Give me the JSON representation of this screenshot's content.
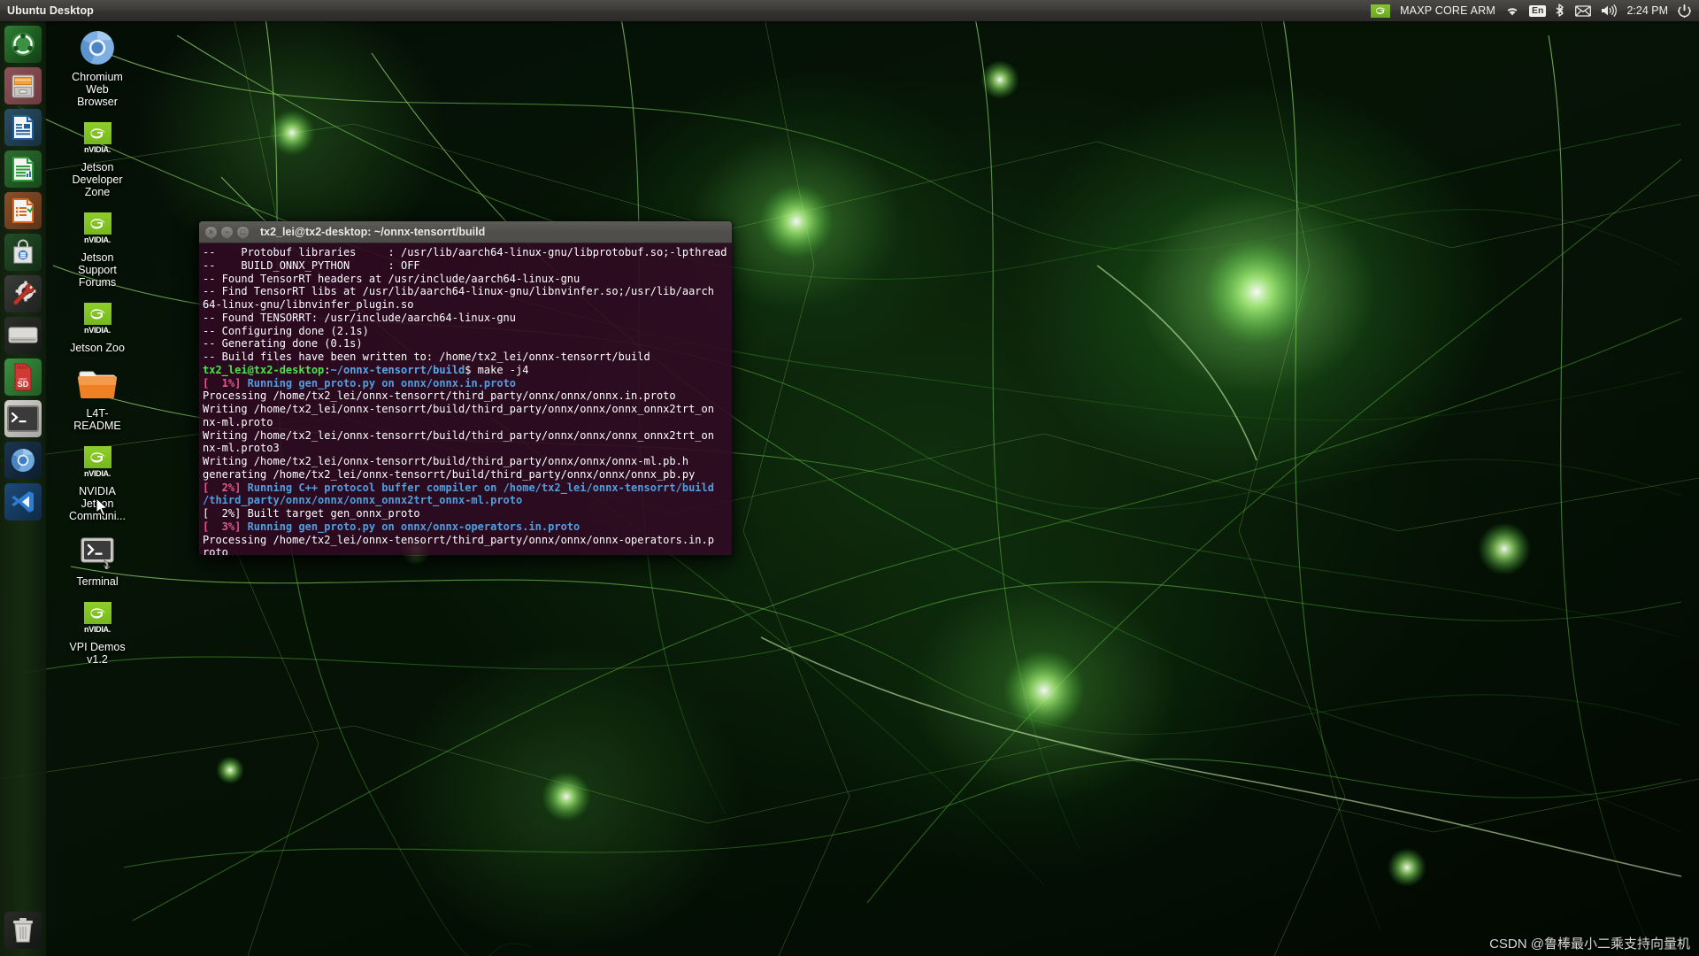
{
  "panel": {
    "title": "Ubuntu Desktop",
    "brand": "MAXP CORE ARM",
    "brand_icon": "nvidia-logo-icon",
    "wifi_icon": "wifi-icon",
    "keyboard_layout": "En",
    "bluetooth_icon": "bluetooth-icon",
    "mail_icon": "envelope-icon",
    "volume_icon": "volume-icon",
    "clock": "2:24 PM",
    "session_icon": "power-gear-icon"
  },
  "launcher": {
    "items": [
      {
        "name": "ubuntu-dash",
        "icon": "ubuntu-logo-icon",
        "running": false
      },
      {
        "name": "files",
        "icon": "file-cabinet-icon",
        "running": true
      },
      {
        "name": "libreoffice-writer",
        "icon": "document-icon",
        "running": false
      },
      {
        "name": "libreoffice-calc",
        "icon": "spreadsheet-icon",
        "running": false
      },
      {
        "name": "libreoffice-impress",
        "icon": "presentation-icon",
        "running": false
      },
      {
        "name": "ubuntu-software",
        "icon": "software-bag-icon",
        "running": false
      },
      {
        "name": "system-settings",
        "icon": "gear-wrench-icon",
        "running": false
      },
      {
        "name": "disk-drive",
        "icon": "hard-drive-icon",
        "running": false
      },
      {
        "name": "sd-card-formatter",
        "icon": "sd-card-icon",
        "running": true
      },
      {
        "name": "terminal",
        "icon": "terminal-icon",
        "running": true
      },
      {
        "name": "chromium",
        "icon": "chromium-icon",
        "running": false
      },
      {
        "name": "vscode",
        "icon": "vscode-icon",
        "running": false
      },
      {
        "name": "trash",
        "icon": "trash-icon",
        "running": false
      }
    ]
  },
  "desktop_icons": [
    {
      "label": "Chromium Web Browser",
      "icon": "chromium-browser-icon"
    },
    {
      "label": "NVIDIA Jetson Developer Zone",
      "icon": "nvidia-icon",
      "nvidia": true,
      "title": "Jetson Developer Zone"
    },
    {
      "label": "NVIDIA Jetson Support Forums",
      "icon": "nvidia-icon",
      "nvidia": true,
      "title": "Jetson Support Forums"
    },
    {
      "label": "NVIDIA Jetson Zoo",
      "icon": "nvidia-icon",
      "nvidia": true,
      "title": "Jetson Zoo"
    },
    {
      "label": "L4T-README",
      "icon": "folder-icon"
    },
    {
      "label": "NVIDIA Jetson Communi...",
      "icon": "nvidia-icon",
      "nvidia": true,
      "title": "NVIDIA Jetson Communi..."
    },
    {
      "label": "Terminal",
      "icon": "terminal-launcher-icon"
    },
    {
      "label": "NVIDIA VPI Demos v1.2",
      "icon": "nvidia-icon",
      "nvidia": true,
      "title": "VPI Demos v1.2"
    }
  ],
  "desktop_icon_labels": {
    "chromium": "Chromium\nWeb\nBrowser",
    "jetson_dev_zone": "Jetson\nDeveloper\nZone",
    "jetson_support": "Jetson\nSupport\nForums",
    "jetson_zoo": "Jetson Zoo",
    "l4t_readme": "L4T-\nREADME",
    "jetson_community": "NVIDIA\nJetson\nCommuni...",
    "terminal": "Terminal",
    "vpi_demos": "VPI Demos\nv1.2",
    "nvidia_wordmark": "nVIDIA."
  },
  "terminal": {
    "title": "tx2_lei@tx2-desktop: ~/onnx-tensorrt/build",
    "close_glyph": "×",
    "minimize_glyph": "−",
    "maximize_glyph": "□",
    "lines": [
      [
        {
          "t": "--    Protobuf libraries     : /usr/lib/aarch64-linux-gnu/libprotobuf.so;-lpthread",
          "c": "c-white"
        }
      ],
      [
        {
          "t": "--    BUILD_ONNX_PYTHON      : OFF",
          "c": "c-white"
        }
      ],
      [
        {
          "t": "-- Found TensorRT headers at /usr/include/aarch64-linux-gnu",
          "c": "c-white"
        }
      ],
      [
        {
          "t": "-- Find TensorRT libs at /usr/lib/aarch64-linux-gnu/libnvinfer.so;/usr/lib/aarch",
          "c": "c-white"
        }
      ],
      [
        {
          "t": "64-linux-gnu/libnvinfer_plugin.so",
          "c": "c-white"
        }
      ],
      [
        {
          "t": "-- Found TENSORRT: /usr/include/aarch64-linux-gnu",
          "c": "c-white"
        }
      ],
      [
        {
          "t": "-- Configuring done (2.1s)",
          "c": "c-white"
        }
      ],
      [
        {
          "t": "-- Generating done (0.1s)",
          "c": "c-white"
        }
      ],
      [
        {
          "t": "-- Build files have been written to: /home/tx2_lei/onnx-tensorrt/build",
          "c": "c-white"
        }
      ],
      [
        {
          "t": "tx2_lei@tx2-desktop",
          "c": "c-green"
        },
        {
          "t": ":",
          "c": "c-white"
        },
        {
          "t": "~/onnx-tensorrt/build",
          "c": "c-blue"
        },
        {
          "t": "$ make -j4",
          "c": "c-white"
        }
      ],
      [
        {
          "t": "[  1%] ",
          "c": "c-mag"
        },
        {
          "t": "Running gen_proto.py on onnx/onnx.in.proto",
          "c": "c-blue2"
        }
      ],
      [
        {
          "t": "Processing /home/tx2_lei/onnx-tensorrt/third_party/onnx/onnx/onnx.in.proto",
          "c": "c-white"
        }
      ],
      [
        {
          "t": "Writing /home/tx2_lei/onnx-tensorrt/build/third_party/onnx/onnx/onnx_onnx2trt_on",
          "c": "c-white"
        }
      ],
      [
        {
          "t": "nx-ml.proto",
          "c": "c-white"
        }
      ],
      [
        {
          "t": "Writing /home/tx2_lei/onnx-tensorrt/build/third_party/onnx/onnx/onnx_onnx2trt_on",
          "c": "c-white"
        }
      ],
      [
        {
          "t": "nx-ml.proto3",
          "c": "c-white"
        }
      ],
      [
        {
          "t": "Writing /home/tx2_lei/onnx-tensorrt/build/third_party/onnx/onnx/onnx-ml.pb.h",
          "c": "c-white"
        }
      ],
      [
        {
          "t": "generating /home/tx2_lei/onnx-tensorrt/build/third_party/onnx/onnx/onnx_pb.py",
          "c": "c-white"
        }
      ],
      [
        {
          "t": "[  2%] ",
          "c": "c-mag"
        },
        {
          "t": "Running C++ protocol buffer compiler on /home/tx2_lei/onnx-tensorrt/build",
          "c": "c-blue2"
        }
      ],
      [
        {
          "t": "/third_party/onnx/onnx/onnx_onnx2trt_onnx-ml.proto",
          "c": "c-blue2"
        }
      ],
      [
        {
          "t": "[  2%] Built target gen_onnx_proto",
          "c": "c-white"
        }
      ],
      [
        {
          "t": "[  3%] ",
          "c": "c-mag"
        },
        {
          "t": "Running gen_proto.py on onnx/onnx-operators.in.proto",
          "c": "c-blue2"
        }
      ],
      [
        {
          "t": "Processing /home/tx2_lei/onnx-tensorrt/third_party/onnx/onnx/onnx-operators.in.p",
          "c": "c-white"
        }
      ],
      [
        {
          "t": "roto",
          "c": "c-white"
        }
      ]
    ]
  },
  "watermark": "CSDN @鲁棒最小二乘支持向量机",
  "colors": {
    "panel_bg": "#3c3b38",
    "terminal_bg": "#300a24",
    "prompt_green": "#4ee24e",
    "prompt_blue": "#5aa7e8",
    "percent_magenta": "#e05a8a",
    "nvidia_green": "#76b81e"
  }
}
